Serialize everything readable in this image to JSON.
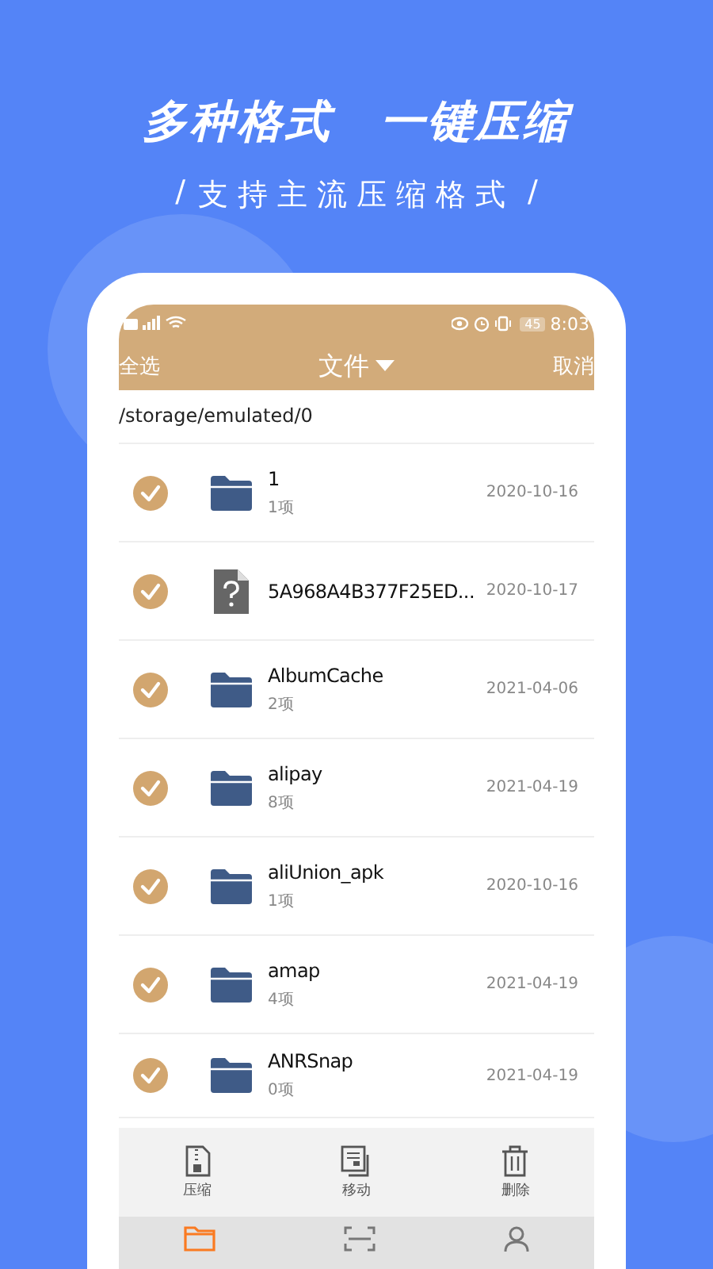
{
  "headline": {
    "left": "多种格式",
    "right": "一键压缩"
  },
  "subtitle": {
    "slash_left": "/",
    "text": "支持主流压缩格式",
    "slash_right": "/"
  },
  "status_bar": {
    "battery": "45",
    "time": "8:03"
  },
  "header": {
    "select_all": "全选",
    "title": "文件",
    "cancel": "取消"
  },
  "path": "/storage/emulated/0",
  "files": [
    {
      "kind": "folder",
      "name": "1",
      "count": "1项",
      "date": "2020-10-16",
      "checked": true
    },
    {
      "kind": "unknown",
      "name": "5A968A4B377F25ED...",
      "date": "2020-10-17",
      "checked": true
    },
    {
      "kind": "folder",
      "name": "AlbumCache",
      "count": "2项",
      "date": "2021-04-06",
      "checked": true
    },
    {
      "kind": "folder",
      "name": "alipay",
      "count": "8项",
      "date": "2021-04-19",
      "checked": true
    },
    {
      "kind": "folder",
      "name": "aliUnion_apk",
      "count": "1项",
      "date": "2020-10-16",
      "checked": true
    },
    {
      "kind": "folder",
      "name": "amap",
      "count": "4项",
      "date": "2021-04-19",
      "checked": true
    },
    {
      "kind": "folder",
      "name": "ANRSnap",
      "count": "0项",
      "date": "2021-04-19",
      "checked": true
    }
  ],
  "actions": [
    {
      "kind": "compress",
      "label": "压缩"
    },
    {
      "kind": "move",
      "label": "移动"
    },
    {
      "kind": "delete",
      "label": "删除"
    }
  ],
  "nav": [
    {
      "kind": "files",
      "selected": true
    },
    {
      "kind": "scan",
      "selected": false
    },
    {
      "kind": "profile",
      "selected": false
    }
  ]
}
